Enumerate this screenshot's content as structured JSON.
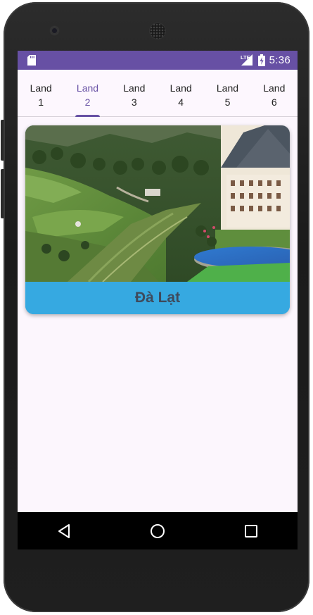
{
  "status_bar": {
    "time": "5:36",
    "network": "LTE",
    "icons": [
      "sd-card-icon",
      "signal-icon",
      "battery-charging-icon"
    ],
    "color": "#6750a4"
  },
  "tabs": [
    {
      "line1": "Land",
      "line2": "1",
      "selected": false
    },
    {
      "line1": "Land",
      "line2": "2",
      "selected": true
    },
    {
      "line1": "Land",
      "line2": "3",
      "selected": false
    },
    {
      "line1": "Land",
      "line2": "4",
      "selected": false
    },
    {
      "line1": "Land",
      "line2": "5",
      "selected": false
    },
    {
      "line1": "Land",
      "line2": "6",
      "selected": false
    }
  ],
  "card": {
    "image_icon": "resort-landscape-photo",
    "title": "Đà Lạt",
    "caption_color": "#36a9e1"
  },
  "nav_bar": {
    "buttons": [
      "back-icon",
      "home-icon",
      "recents-icon"
    ]
  },
  "colors": {
    "accent": "#6750a4",
    "background": "#fcf6fd"
  }
}
